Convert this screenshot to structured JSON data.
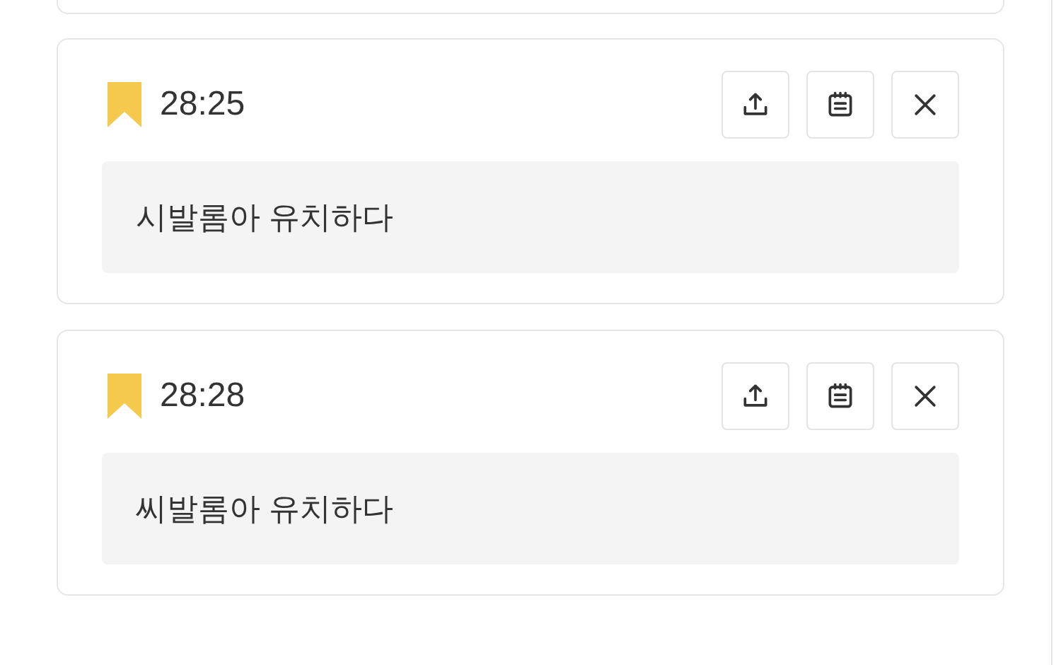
{
  "bookmarks": [
    {
      "time": "28:25",
      "note": "시발롬아 유치하다"
    },
    {
      "time": "28:28",
      "note": "씨발롬아 유치하다"
    }
  ]
}
